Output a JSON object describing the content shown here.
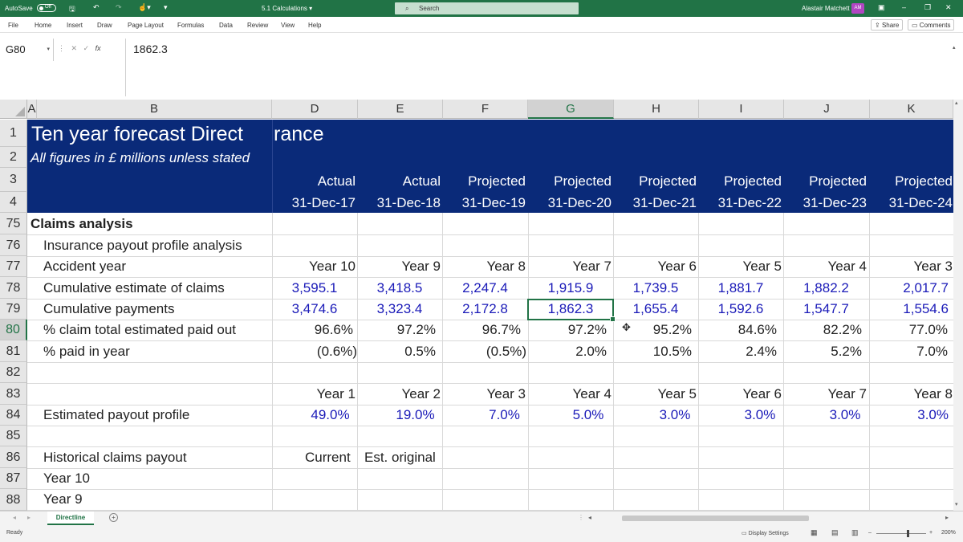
{
  "titlebar": {
    "autosave_label": "AutoSave",
    "autosave_state": "Off",
    "save_icon": "save-icon",
    "undo_icon": "undo-icon",
    "redo_icon": "redo-icon",
    "doc_title": "5.1 Calculations",
    "doc_title_caret": "▾",
    "search_placeholder": "Search",
    "user_name": "Alastair Matchett",
    "user_initials": "AM"
  },
  "menu": {
    "items": [
      "File",
      "Home",
      "Insert",
      "Draw",
      "Page Layout",
      "Formulas",
      "Data",
      "Review",
      "View",
      "Help"
    ],
    "share_label": "Share",
    "comments_label": "Comments"
  },
  "formula_bar": {
    "name_box": "G80",
    "fx": "fx",
    "value": "1862.3"
  },
  "grid": {
    "columns": [
      "A",
      "B",
      "D",
      "E",
      "F",
      "G",
      "H",
      "I",
      "J",
      "K"
    ],
    "selected_column": "G",
    "rows": [
      "1",
      "2",
      "3",
      "4",
      "75",
      "76",
      "77",
      "78",
      "79",
      "80",
      "81",
      "82",
      "83",
      "84",
      "85",
      "86",
      "87",
      "88"
    ],
    "selected_row": "80",
    "title": "Ten year forecast Direct",
    "title_overflow": "rance",
    "subtitle": "All figures in £ millions unless stated",
    "header_row3": [
      "Actual",
      "Actual",
      "Projected",
      "Projected",
      "Projected",
      "Projected",
      "Projected",
      "Projected"
    ],
    "header_row4": [
      "31-Dec-17",
      "31-Dec-18",
      "31-Dec-19",
      "31-Dec-20",
      "31-Dec-21",
      "31-Dec-22",
      "31-Dec-23",
      "31-Dec-24"
    ],
    "section": "Claims analysis",
    "r76_label": "Insurance payout profile analysis",
    "r77_label": "Accident year",
    "r77": [
      "Year 10",
      "Year 9",
      "Year 8",
      "Year 7",
      "Year 6",
      "Year 5",
      "Year 4",
      "Year 3"
    ],
    "r78_label": "Cumulative estimate of claims",
    "r78": [
      "3,595.1",
      "3,418.5",
      "2,247.4",
      "1,915.9",
      "1,739.5",
      "1,881.7",
      "1,882.2",
      "2,017.7"
    ],
    "r79_label": "Cumulative payments",
    "r79": [
      "3,474.6",
      "3,323.4",
      "2,172.8",
      "1,862.3",
      "1,655.4",
      "1,592.6",
      "1,547.7",
      "1,554.6"
    ],
    "r80_label": "% claim total estimated paid out",
    "r80": [
      "96.6%",
      "97.2%",
      "96.7%",
      "97.2%",
      "95.2%",
      "84.6%",
      "82.2%",
      "77.0%"
    ],
    "r81_label": "% paid in year",
    "r81": [
      "(0.6%)",
      "0.5%",
      "(0.5%)",
      "2.0%",
      "10.5%",
      "2.4%",
      "5.2%",
      "7.0%"
    ],
    "r83": [
      "Year 1",
      "Year 2",
      "Year 3",
      "Year 4",
      "Year 5",
      "Year 6",
      "Year 7",
      "Year 8"
    ],
    "r84_label": "Estimated payout profile",
    "r84": [
      "49.0%",
      "19.0%",
      "7.0%",
      "5.0%",
      "3.0%",
      "3.0%",
      "3.0%",
      "3.0%"
    ],
    "r86_label": "Historical claims payout",
    "r86_d": "Current",
    "r86_e": "Est. original",
    "r87_label": "Year 10",
    "r88_label": "Year 9"
  },
  "sheet_tabs": {
    "active": "Directline",
    "add": "+"
  },
  "status": {
    "ready": "Ready",
    "display_settings": "Display Settings",
    "zoom": "200%"
  },
  "colors": {
    "accent": "#217346",
    "header_fill": "#0a2a79",
    "input_blue": "#1a1ab8"
  }
}
